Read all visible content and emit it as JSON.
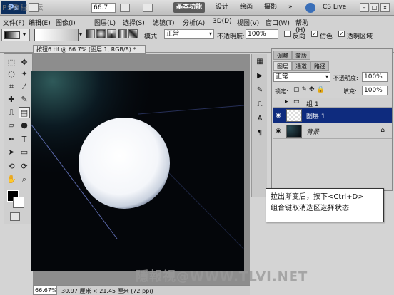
{
  "watermark_top": "PS教程论坛",
  "app_bar": {
    "logo": "Ps",
    "zoom_field": "66.7",
    "workspaces": [
      "基本功能",
      "设计",
      "绘画",
      "摄影"
    ],
    "cs_live": "CS Live"
  },
  "menu": [
    "文件(F)",
    "编辑(E)",
    "图像(I)",
    "图层(L)",
    "选择(S)",
    "滤镜(T)",
    "分析(A)",
    "3D(D)",
    "视图(V)",
    "窗口(W)",
    "帮助(H)"
  ],
  "options": {
    "mode_label": "模式:",
    "mode_value": "正常",
    "opacity_label": "不透明度:",
    "opacity_value": "100%",
    "reverse_label": "反向",
    "dither_label": "仿色",
    "transparency_label": "透明区域"
  },
  "document": {
    "tab_title": "按钮6.tif @ 66.7% (图层 1, RGB/8) *",
    "zoom": "66.67%",
    "size_info": "30.97 厘米 × 21.45 厘米 (72 ppi)"
  },
  "layers_panel": {
    "tabs_top": [
      "调整",
      "蒙版"
    ],
    "tabs": [
      "图层",
      "通道",
      "路径"
    ],
    "blend_mode": "正常",
    "opacity_label": "不透明度:",
    "opacity_value": "100%",
    "lock_label": "锁定:",
    "fill_label": "填充:",
    "fill_value": "100%",
    "layers": [
      {
        "name": "组 1",
        "type": "group"
      },
      {
        "name": "图层 1",
        "type": "layer",
        "selected": true
      },
      {
        "name": "背景",
        "type": "background",
        "locked": true
      }
    ]
  },
  "callout": {
    "line1": "拉出渐变后，按下<Ctrl+D>",
    "line2": "组合键取消选区选择状态"
  },
  "watermark_bottom": "隱報視@WWW.TLVI.NET"
}
